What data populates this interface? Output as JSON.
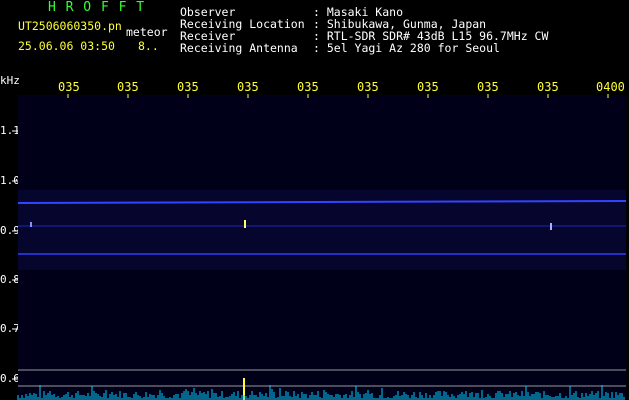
{
  "header": {
    "app_name": "H R O F F T",
    "file_name": "UT2506060350.pn",
    "mode": "meteor",
    "datetime": "25.06.06 03:50",
    "count": "8..",
    "fields": [
      {
        "label": "Observer",
        "value": ": Masaki Kano"
      },
      {
        "label": "Receiving Location",
        "value": ": Shibukawa, Gunma, Japan"
      },
      {
        "label": "Receiver",
        "value": ": RTL-SDR SDR# 43dB L15 96.7MHz CW"
      },
      {
        "label": "Receiving Antenna",
        "value": ": 5el Yagi Az 280 for Seoul"
      }
    ]
  },
  "axis": {
    "unit": "kHz",
    "x_ticks": [
      "035",
      "035",
      "035",
      "035",
      "035",
      "035",
      "035",
      "035",
      "035",
      "0400"
    ],
    "y_ticks": [
      "1.1",
      "1.0",
      "0.9",
      "0.8",
      "0.7",
      "0.6"
    ]
  },
  "colors": {
    "background": "#000000",
    "panel": "#000018",
    "signal": "#3344ff",
    "text_yellow": "#ffff33",
    "text_green": "#33ff33",
    "spectrum": "#00ccff"
  }
}
